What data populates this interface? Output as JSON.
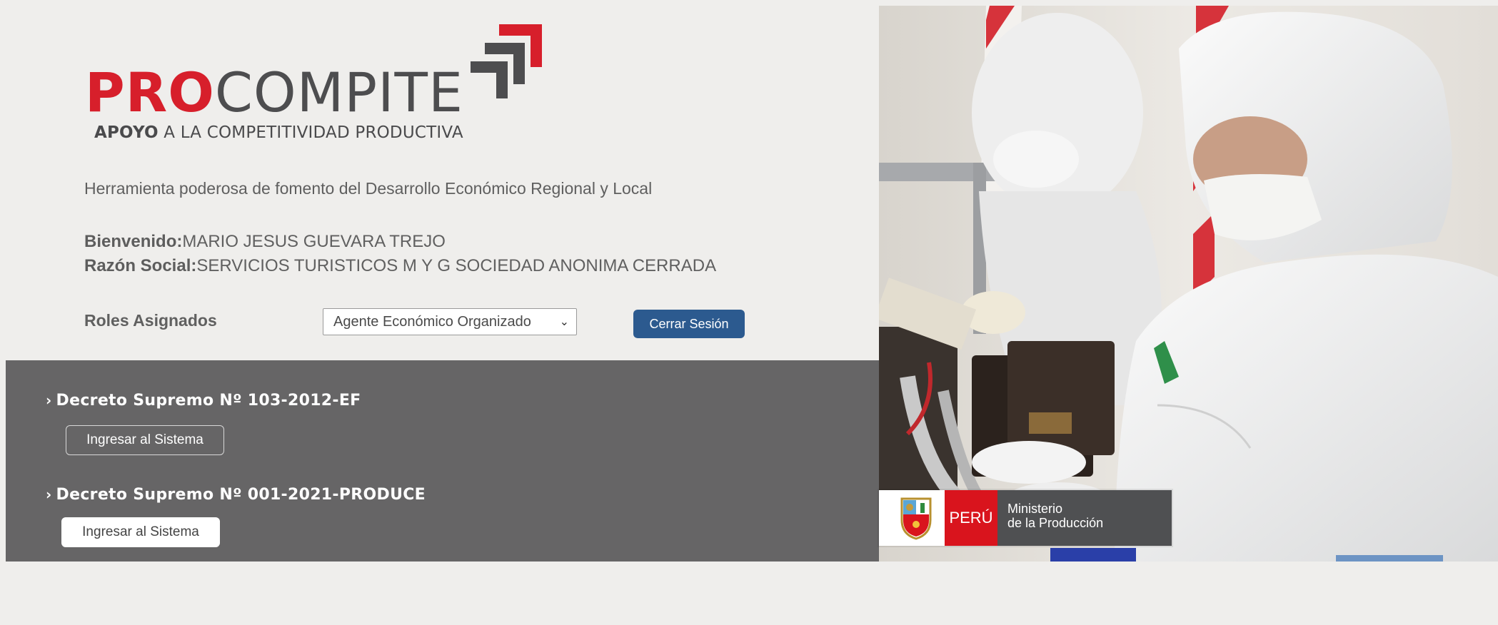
{
  "logo": {
    "pro": "PRO",
    "compite": "COMPITE",
    "tag_bold": "APOYO",
    "tag_rest": " A LA COMPETITIVIDAD PRODUCTIVA"
  },
  "tagline": "Herramienta poderosa de fomento del Desarrollo Económico Regional y Local",
  "session": {
    "welcome_label": "Bienvenido:",
    "welcome_value": "MARIO JESUS GUEVARA TREJO",
    "razon_label": "Razón Social:",
    "razon_value": "SERVICIOS TURISTICOS M Y G SOCIEDAD ANONIMA CERRADA"
  },
  "roles": {
    "label": "Roles Asignados",
    "selected": "Agente Económico Organizado",
    "logout_label": "Cerrar Sesión"
  },
  "decrees": [
    {
      "title": "Decreto Supremo Nº 103-2012-EF",
      "button": "Ingresar al Sistema"
    },
    {
      "title": "Decreto Supremo Nº 001-2021-PRODUCE",
      "button": "Ingresar al Sistema"
    }
  ],
  "badge": {
    "country": "PERÚ",
    "ministry_line1": "Ministerio",
    "ministry_line2": "de la Producción"
  },
  "colors": {
    "brand_red": "#d71f2b",
    "brand_gray": "#4d4d4f",
    "logout_blue": "#2c5a8f",
    "panel_gray": "#666566"
  },
  "icons": {
    "select_chevron": "chevron-down-icon",
    "decree_arrow": "chevron-right-icon",
    "badge_shield": "peru-coat-of-arms-icon"
  }
}
